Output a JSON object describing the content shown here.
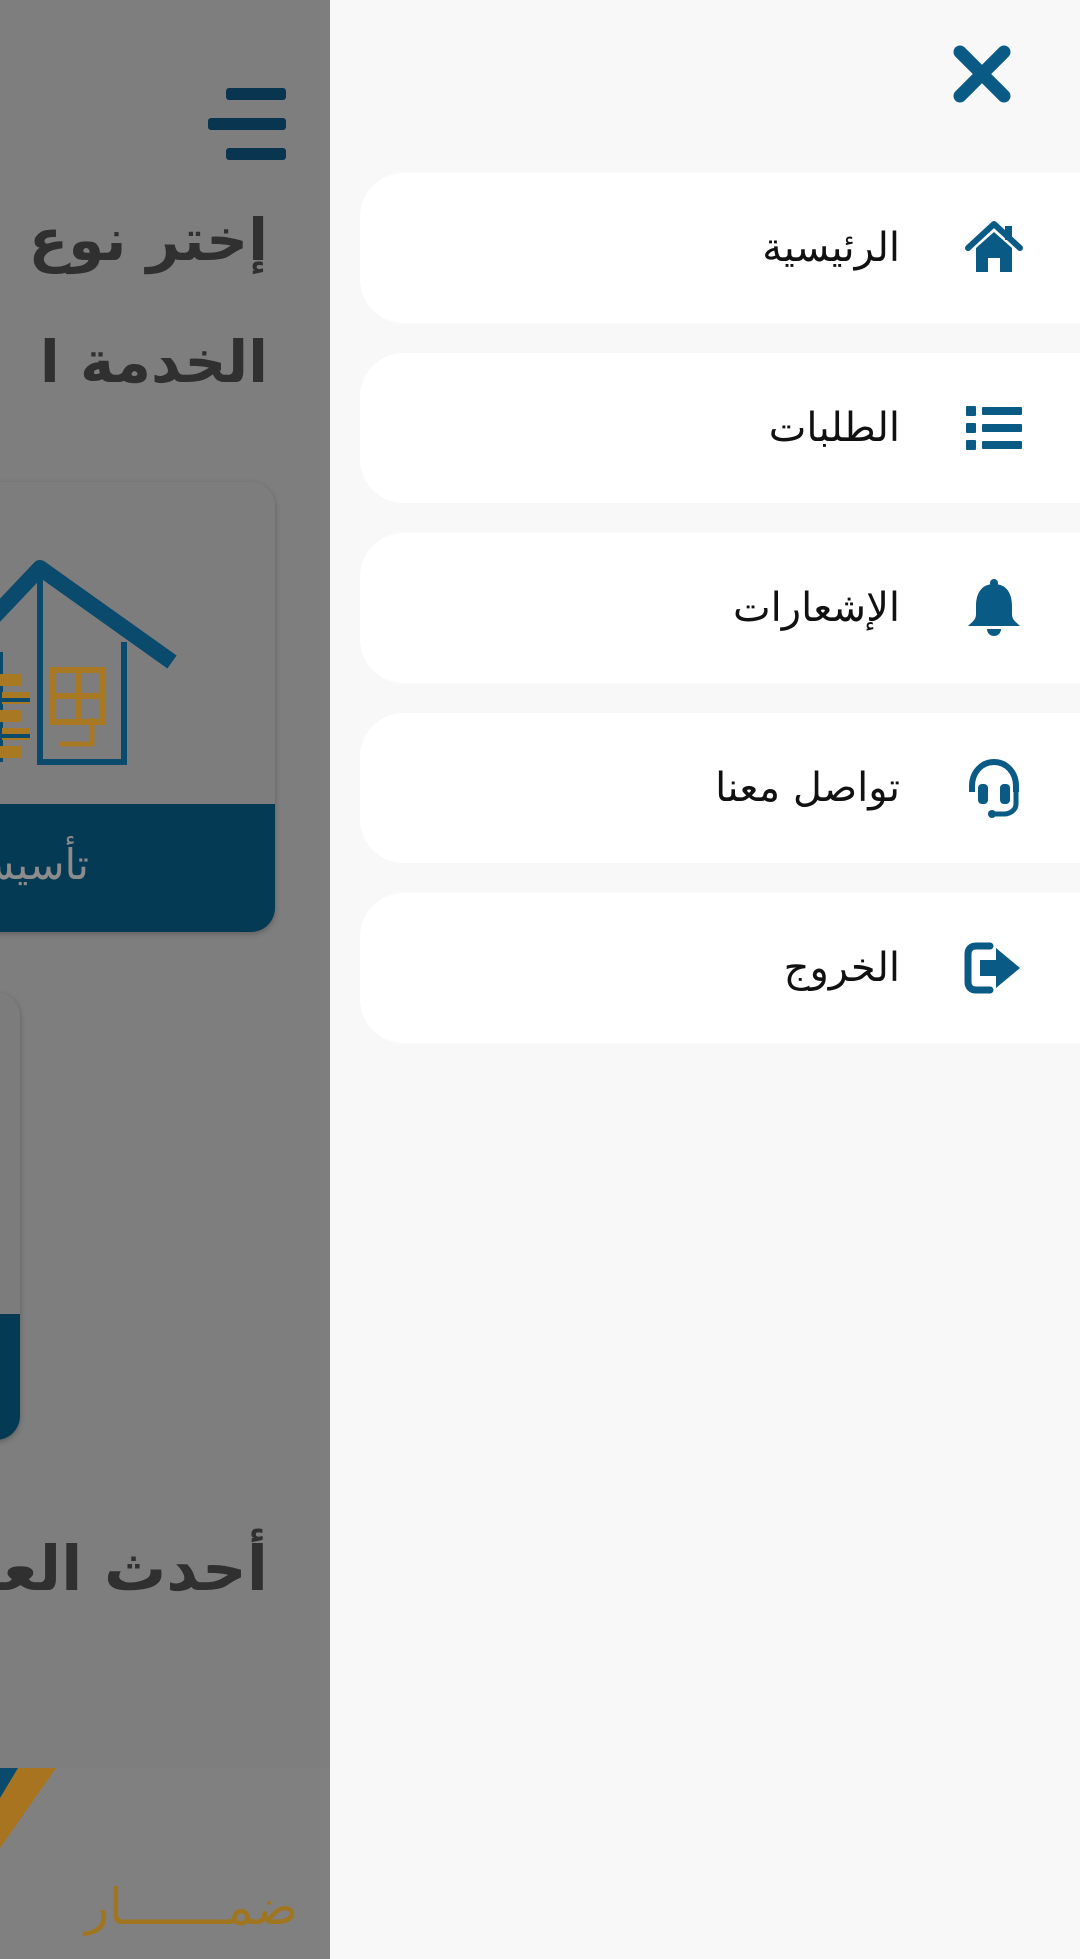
{
  "background": {
    "heading_line1": "إختر نوع",
    "heading_line2": "الخدمة ا",
    "card_label": "تأسيس",
    "section_title": "أحدث العـ",
    "logo_text": "ضمـــــــار"
  },
  "drawer": {
    "items": [
      {
        "label": "الرئيسية",
        "icon": "home-icon"
      },
      {
        "label": "الطلبات",
        "icon": "list-icon"
      },
      {
        "label": "الإشعارات",
        "icon": "bell-icon"
      },
      {
        "label": "تواصل معنا",
        "icon": "headset-icon"
      },
      {
        "label": "الخروج",
        "icon": "logout-icon"
      }
    ]
  },
  "colors": {
    "primary": "#0a5a86",
    "dark_primary": "#053a54",
    "accent": "#c98a1f",
    "overlay": "#7e7e7e",
    "drawer_bg": "#f8f8f8"
  }
}
